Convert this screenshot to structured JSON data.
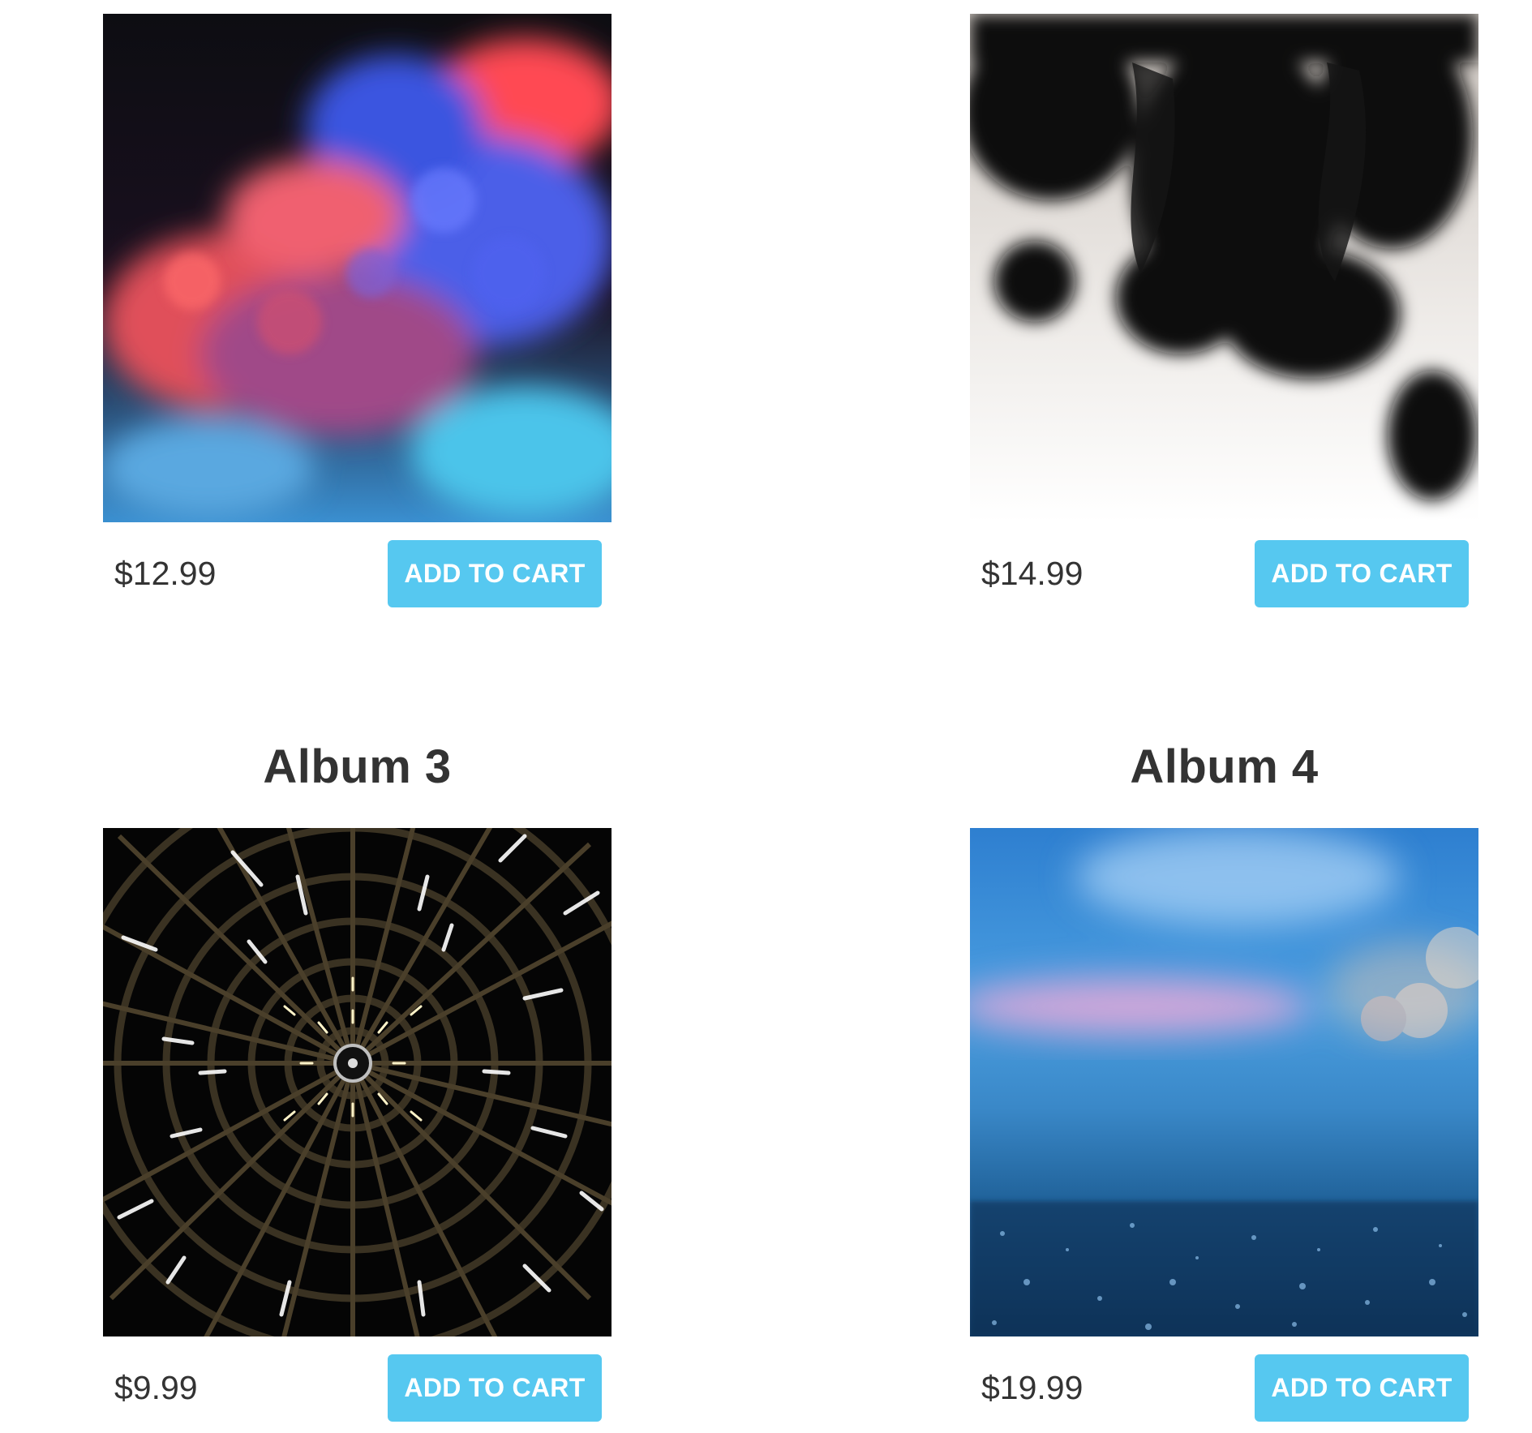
{
  "products": [
    {
      "title": "",
      "price": "$12.99",
      "button": "ADD TO CART",
      "art": "colored-smoke"
    },
    {
      "title": "",
      "price": "$14.99",
      "button": "ADD TO CART",
      "art": "black-ink"
    },
    {
      "title": "Album 3",
      "price": "$9.99",
      "button": "ADD TO CART",
      "art": "spiral-ceiling"
    },
    {
      "title": "Album 4",
      "price": "$19.99",
      "button": "ADD TO CART",
      "art": "blue-bokeh"
    }
  ],
  "colors": {
    "button_bg": "#56c8f0",
    "button_text": "#ffffff",
    "text": "#333333"
  }
}
